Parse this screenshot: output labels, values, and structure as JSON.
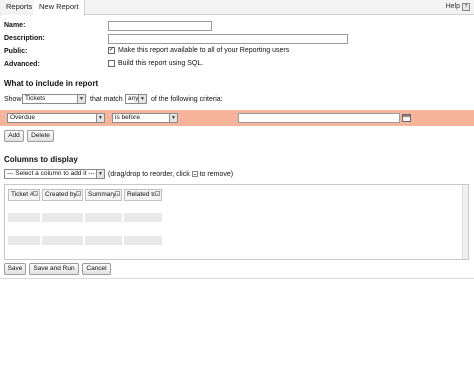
{
  "tabs": [
    {
      "label": "Reports"
    },
    {
      "label": "New Report"
    }
  ],
  "help": {
    "label": "Help"
  },
  "form": {
    "name_label": "Name:",
    "description_label": "Description:",
    "public_label": "Public:",
    "public_text": "Make this report available to all of your Reporting users",
    "public_checked": true,
    "advanced_label": "Advanced:",
    "advanced_text": "Build this report using SQL.",
    "advanced_checked": false
  },
  "include": {
    "heading": "What to include in report",
    "show_label": "Show",
    "show_value": "Tickets",
    "match_label": "that match",
    "match_value": "any",
    "criteria_label": "of the following criteria:"
  },
  "criteria": {
    "field_value": "Overdue",
    "operator_value": "is before",
    "value_text": ""
  },
  "criteria_buttons": {
    "add": "Add",
    "delete": "Delete"
  },
  "columns": {
    "heading": "Columns to display",
    "select_placeholder": "--- Select a column to add it ---",
    "hint_before": "(drag/drop to reorder, click",
    "hint_after": "to remove)",
    "headers": [
      "Ticket #",
      "Created by",
      "Summary",
      "Related to"
    ]
  },
  "footer_buttons": {
    "save": "Save",
    "save_and_run": "Save and Run",
    "cancel": "Cancel"
  }
}
